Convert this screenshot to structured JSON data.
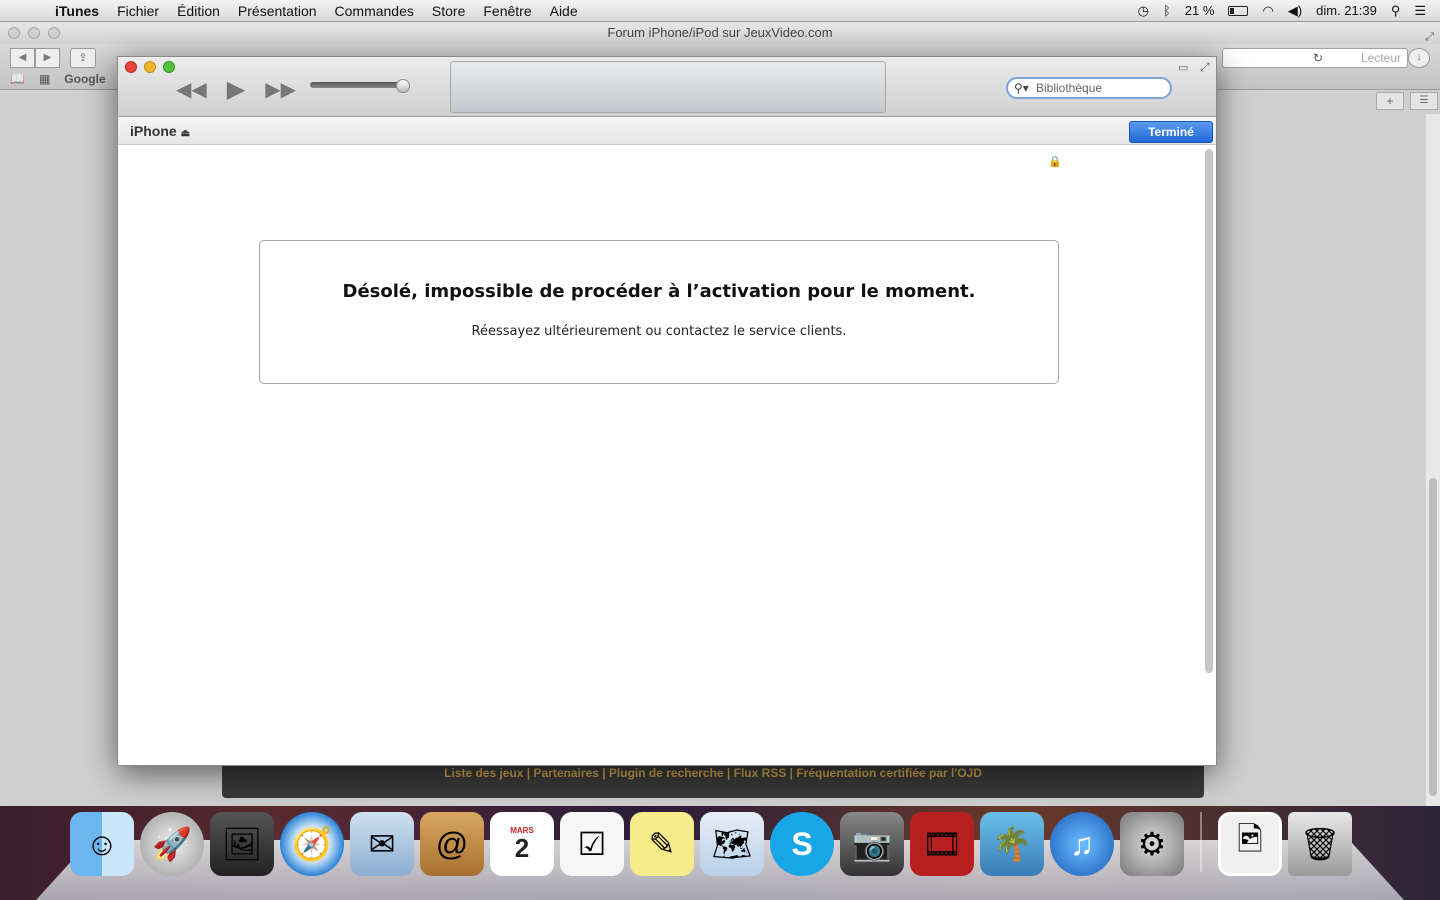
{
  "menubar": {
    "apple": "",
    "app": "iTunes",
    "items": [
      "Fichier",
      "Édition",
      "Présentation",
      "Commandes",
      "Store",
      "Fenêtre",
      "Aide"
    ],
    "battery_pct": "21 %",
    "clock": "dim. 21:39"
  },
  "safari": {
    "title": "Forum iPhone/iPod sur JeuxVideo.com",
    "bookmark_label": "Google",
    "reader_label": "Lecteur",
    "footer_text": "Liste des jeux | Partenaires | Plugin de recherche | Flux RSS | Fréquentation certifiée par l'OJD"
  },
  "itunes": {
    "search_placeholder": "Bibliothèque",
    "device_name": "iPhone",
    "done_label": "Terminé",
    "message_title": "Désolé, impossible de procéder à l’activation pour le moment.",
    "message_subtitle": "Réessayez ultérieurement ou contactez le service clients."
  },
  "dock": {
    "calendar_month": "MARS",
    "calendar_day": "2",
    "skype_letter": "S"
  },
  "colors": {
    "done_button": "#2068d8",
    "close_light": "#e9453a",
    "minimize_light": "#f3b52c",
    "zoom_light": "#55c23c"
  }
}
